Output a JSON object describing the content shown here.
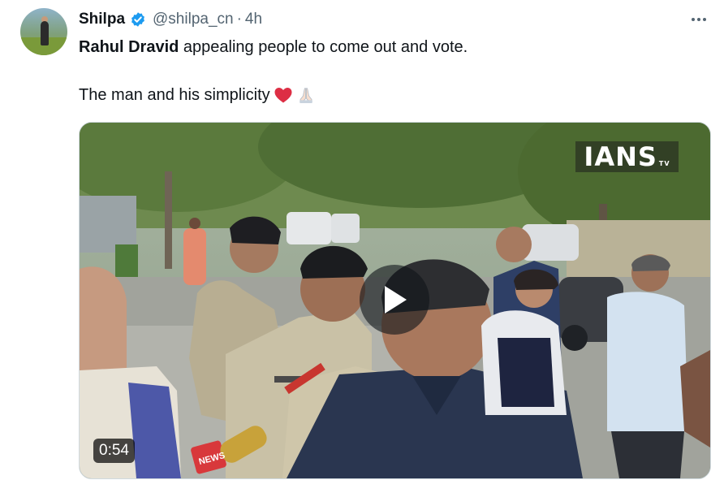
{
  "tweet": {
    "author_name": "Shilpa",
    "handle": "@shilpa_cn",
    "separator": "·",
    "time": "4h",
    "text_bold": "Rahul Dravid",
    "text_rest": " appealing people to come out and vote.",
    "text_line2": "The man and his simplicity",
    "emojis": [
      "red-heart",
      "folded-hands"
    ]
  },
  "media": {
    "watermark": "IANS",
    "watermark_sub": "TV",
    "duration": "0:54",
    "mic_text": "NEWS"
  },
  "colors": {
    "verified": "#1d9bf0",
    "text": "#0f1419",
    "secondary": "#536471",
    "border": "#cfd9de"
  }
}
